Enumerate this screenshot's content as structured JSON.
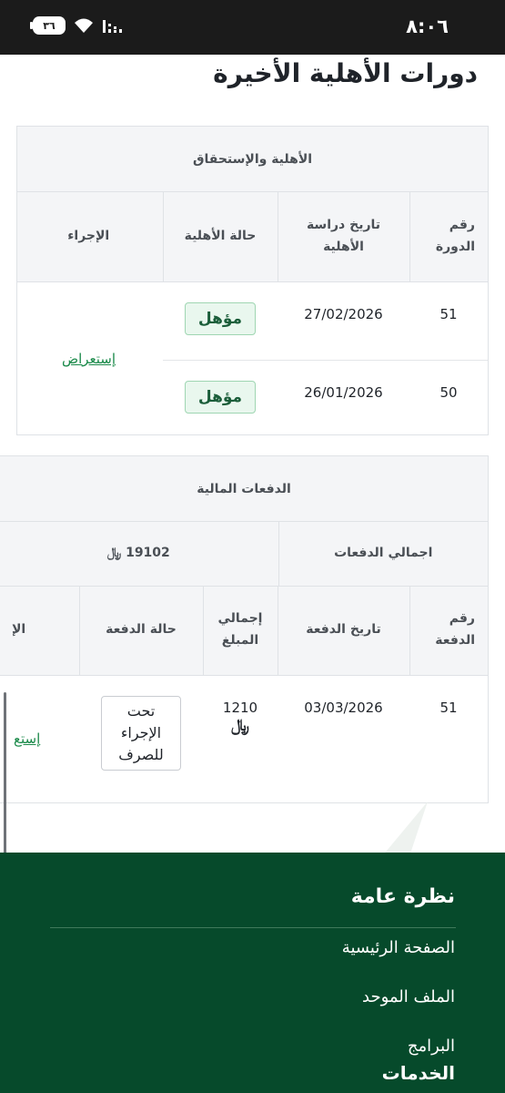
{
  "status_bar": {
    "time": "٨:٠٦",
    "battery": "٣٦",
    "icons": [
      "battery-icon",
      "wifi-icon",
      "signal-icon"
    ]
  },
  "page": {
    "title": "دورات الأهلية الأخيرة"
  },
  "eligibility": {
    "header": "الأهلية والإستحقاق",
    "columns": [
      "رقم الدورة",
      "تاريخ دراسة الأهلية",
      "حالة الأهلية",
      "الإجراء"
    ],
    "rows": [
      {
        "cycle": "51",
        "date": "27/02/2026",
        "status": "مؤهل"
      },
      {
        "cycle": "50",
        "date": "26/01/2026",
        "status": "مؤهل"
      }
    ],
    "action_label": "إستعراض"
  },
  "payments": {
    "header": "الدفعات المالية",
    "total_label": "اجمالي الدفعات",
    "total_value": "19102",
    "currency_symbol": "⃁",
    "columns": [
      "رقم الدفعة",
      "تاريخ الدفعة",
      "إجمالي المبلغ",
      "حالة الدفعة",
      "الإ"
    ],
    "rows": [
      {
        "payment": "51",
        "date": "03/03/2026",
        "amount": "1210",
        "status": "تحت الإجراء للصرف"
      }
    ],
    "action_label": "إستع"
  },
  "footer": {
    "title": "نظرة عامة",
    "links": [
      "الصفحة الرئيسية",
      "الملف الموحد",
      "البرامج"
    ],
    "section": "الخدمات"
  },
  "colors": {
    "footer_bg": "#064a2b",
    "accent_green": "#1b8a4a",
    "badge_bg": "#e9f7ee"
  }
}
